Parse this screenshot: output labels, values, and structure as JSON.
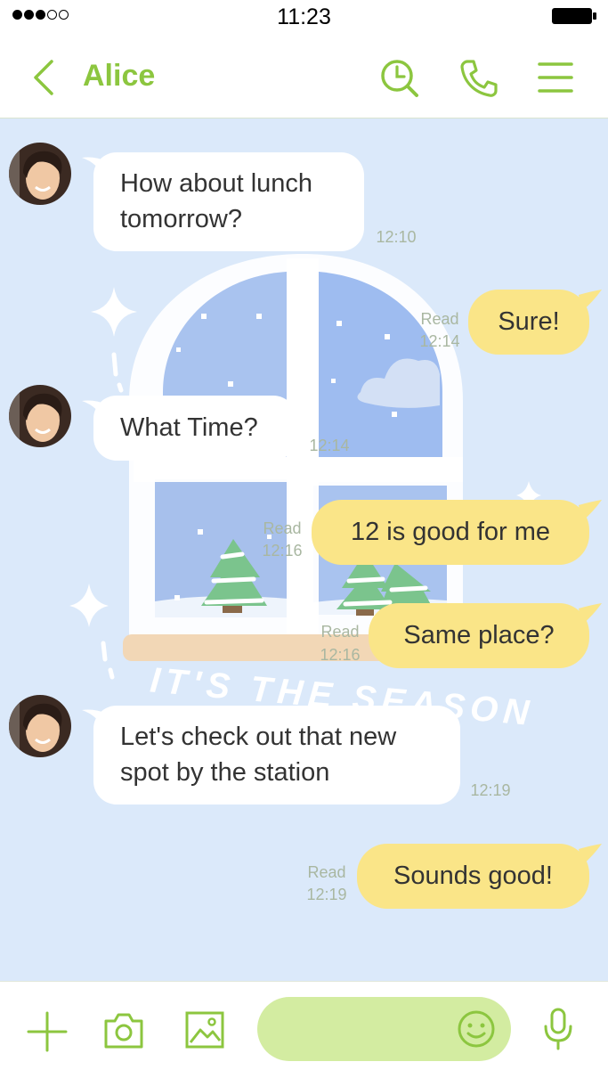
{
  "status_bar": {
    "time": "11:23",
    "signal_bars": 3,
    "signal_total": 5,
    "battery_icon": "battery-full-icon"
  },
  "header": {
    "title": "Alice",
    "back_icon": "chevron-left-icon",
    "actions": [
      "clock-search-icon",
      "phone-icon",
      "menu-icon"
    ]
  },
  "colors": {
    "accent": "#8cc63f",
    "chat_background": "#dbe9fa",
    "incoming_bubble": "#ffffff",
    "outgoing_bubble": "#fae588",
    "input_field": "#d3eca1"
  },
  "messages": [
    {
      "direction": "incoming",
      "text_lines": [
        "How about lunch",
        "tomorrow?"
      ],
      "time": "12:10"
    },
    {
      "direction": "outgoing",
      "text": "Sure!",
      "read": "Read",
      "time": "12:14"
    },
    {
      "direction": "incoming",
      "text": "What Time?",
      "time": "12:14"
    },
    {
      "direction": "outgoing",
      "text": "12 is good for me",
      "read": "Read",
      "time": "12:16"
    },
    {
      "direction": "outgoing",
      "text": "Same place?",
      "read": "Read",
      "time": "12:16"
    },
    {
      "direction": "incoming",
      "text_lines": [
        "Let's check out that new",
        "spot by the station"
      ],
      "time": "12:19"
    },
    {
      "direction": "outgoing",
      "text": "Sounds good!",
      "read": "Read",
      "time": "12:19"
    }
  ],
  "background_art": {
    "text": "IT'S THE SEASON"
  },
  "input_bar": {
    "tools": [
      "plus-icon",
      "camera-icon",
      "image-icon"
    ],
    "input_value": "",
    "emoji_icon": "smiley-icon",
    "mic_icon": "microphone-icon"
  }
}
